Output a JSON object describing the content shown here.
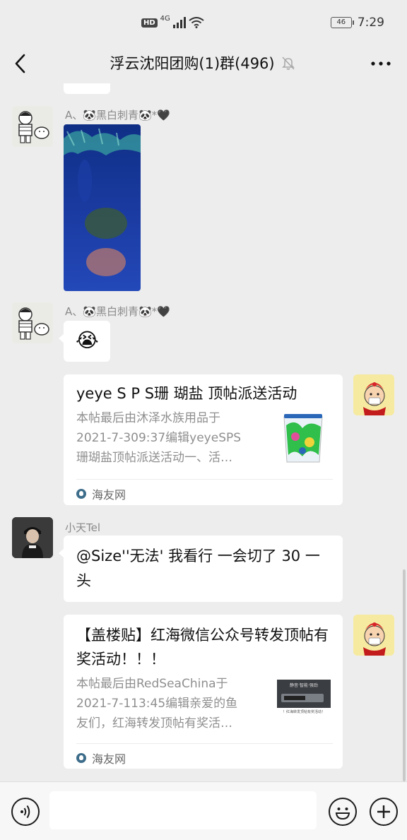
{
  "status": {
    "hd": "HD",
    "network": "4G",
    "battery": "46",
    "time": "7:29"
  },
  "header": {
    "title": "浮云沈阳团购(1)群(496)"
  },
  "messages": {
    "sender1": "A、🐼黑白刺青🐼*🖤",
    "sender2": "A、🐼黑白刺青🐼*🖤",
    "emoji": "😭",
    "card1": {
      "title": "yeye S P S珊 瑚盐 顶帖派送活动",
      "desc": "本帖最后由沐泽水族用品于\n2021-7-309:37编辑yeyeSPS\n珊瑚盐顶帖派送活动一、活…",
      "source": "海友网"
    },
    "sender3": "小天Tel",
    "text3": "@Size''无法'  我看行 一会切了 30 一头",
    "card2": {
      "title": "【盖楼贴】红海微信公众号转发顶帖有奖活动！！！",
      "desc": "本帖最后由RedSeaChina于\n2021-7-113:45编辑亲爱的鱼\n友们，红海转发顶帖有奖活…",
      "source": "海友网",
      "thumb_caption": "！红海转发顶帖有奖活动！"
    }
  }
}
